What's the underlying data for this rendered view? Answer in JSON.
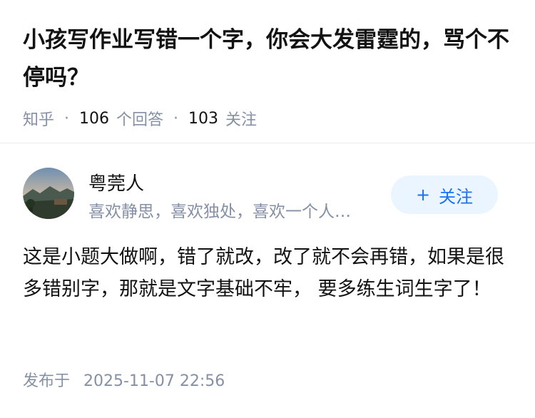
{
  "question": {
    "title": "小孩写作业写错一个字，你会大发雷霆的，骂个不停吗？",
    "source": "知乎",
    "answers_count": "106",
    "answers_label": "个回答",
    "followers_count": "103",
    "followers_label": "关注"
  },
  "author": {
    "name": "粤莞人",
    "bio": "喜欢静思，喜欢独处，喜欢一个人…",
    "follow_label": "关注",
    "avatar_icon": "avatar-landscape-photo"
  },
  "answer": {
    "content": "这是小题大做啊，错了就改，改了就不会再错，如果是很多错别字，那就是文字基础不牢， 要多练生词生字了！",
    "published_label": "发布于",
    "published_time": "2025-11-07 22:56"
  },
  "colors": {
    "accent": "#1772f6",
    "button_bg": "#ebf5ff",
    "muted": "#8590a6",
    "text": "#121212"
  }
}
